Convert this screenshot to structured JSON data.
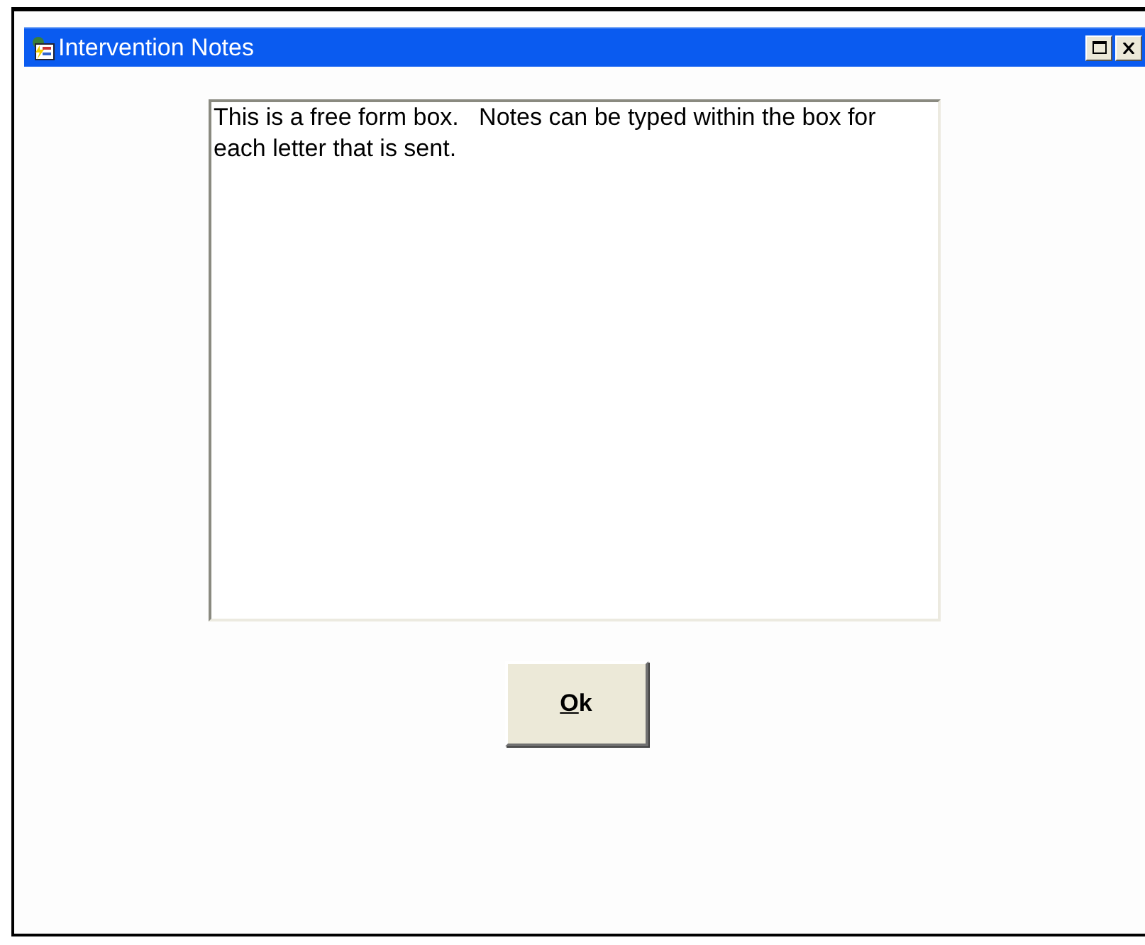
{
  "window": {
    "title": "Intervention Notes"
  },
  "notes": {
    "value": "This is a free form box.   Notes can be typed within the box for each letter that is sent."
  },
  "buttons": [
    {
      "label": "Ok"
    }
  ]
}
